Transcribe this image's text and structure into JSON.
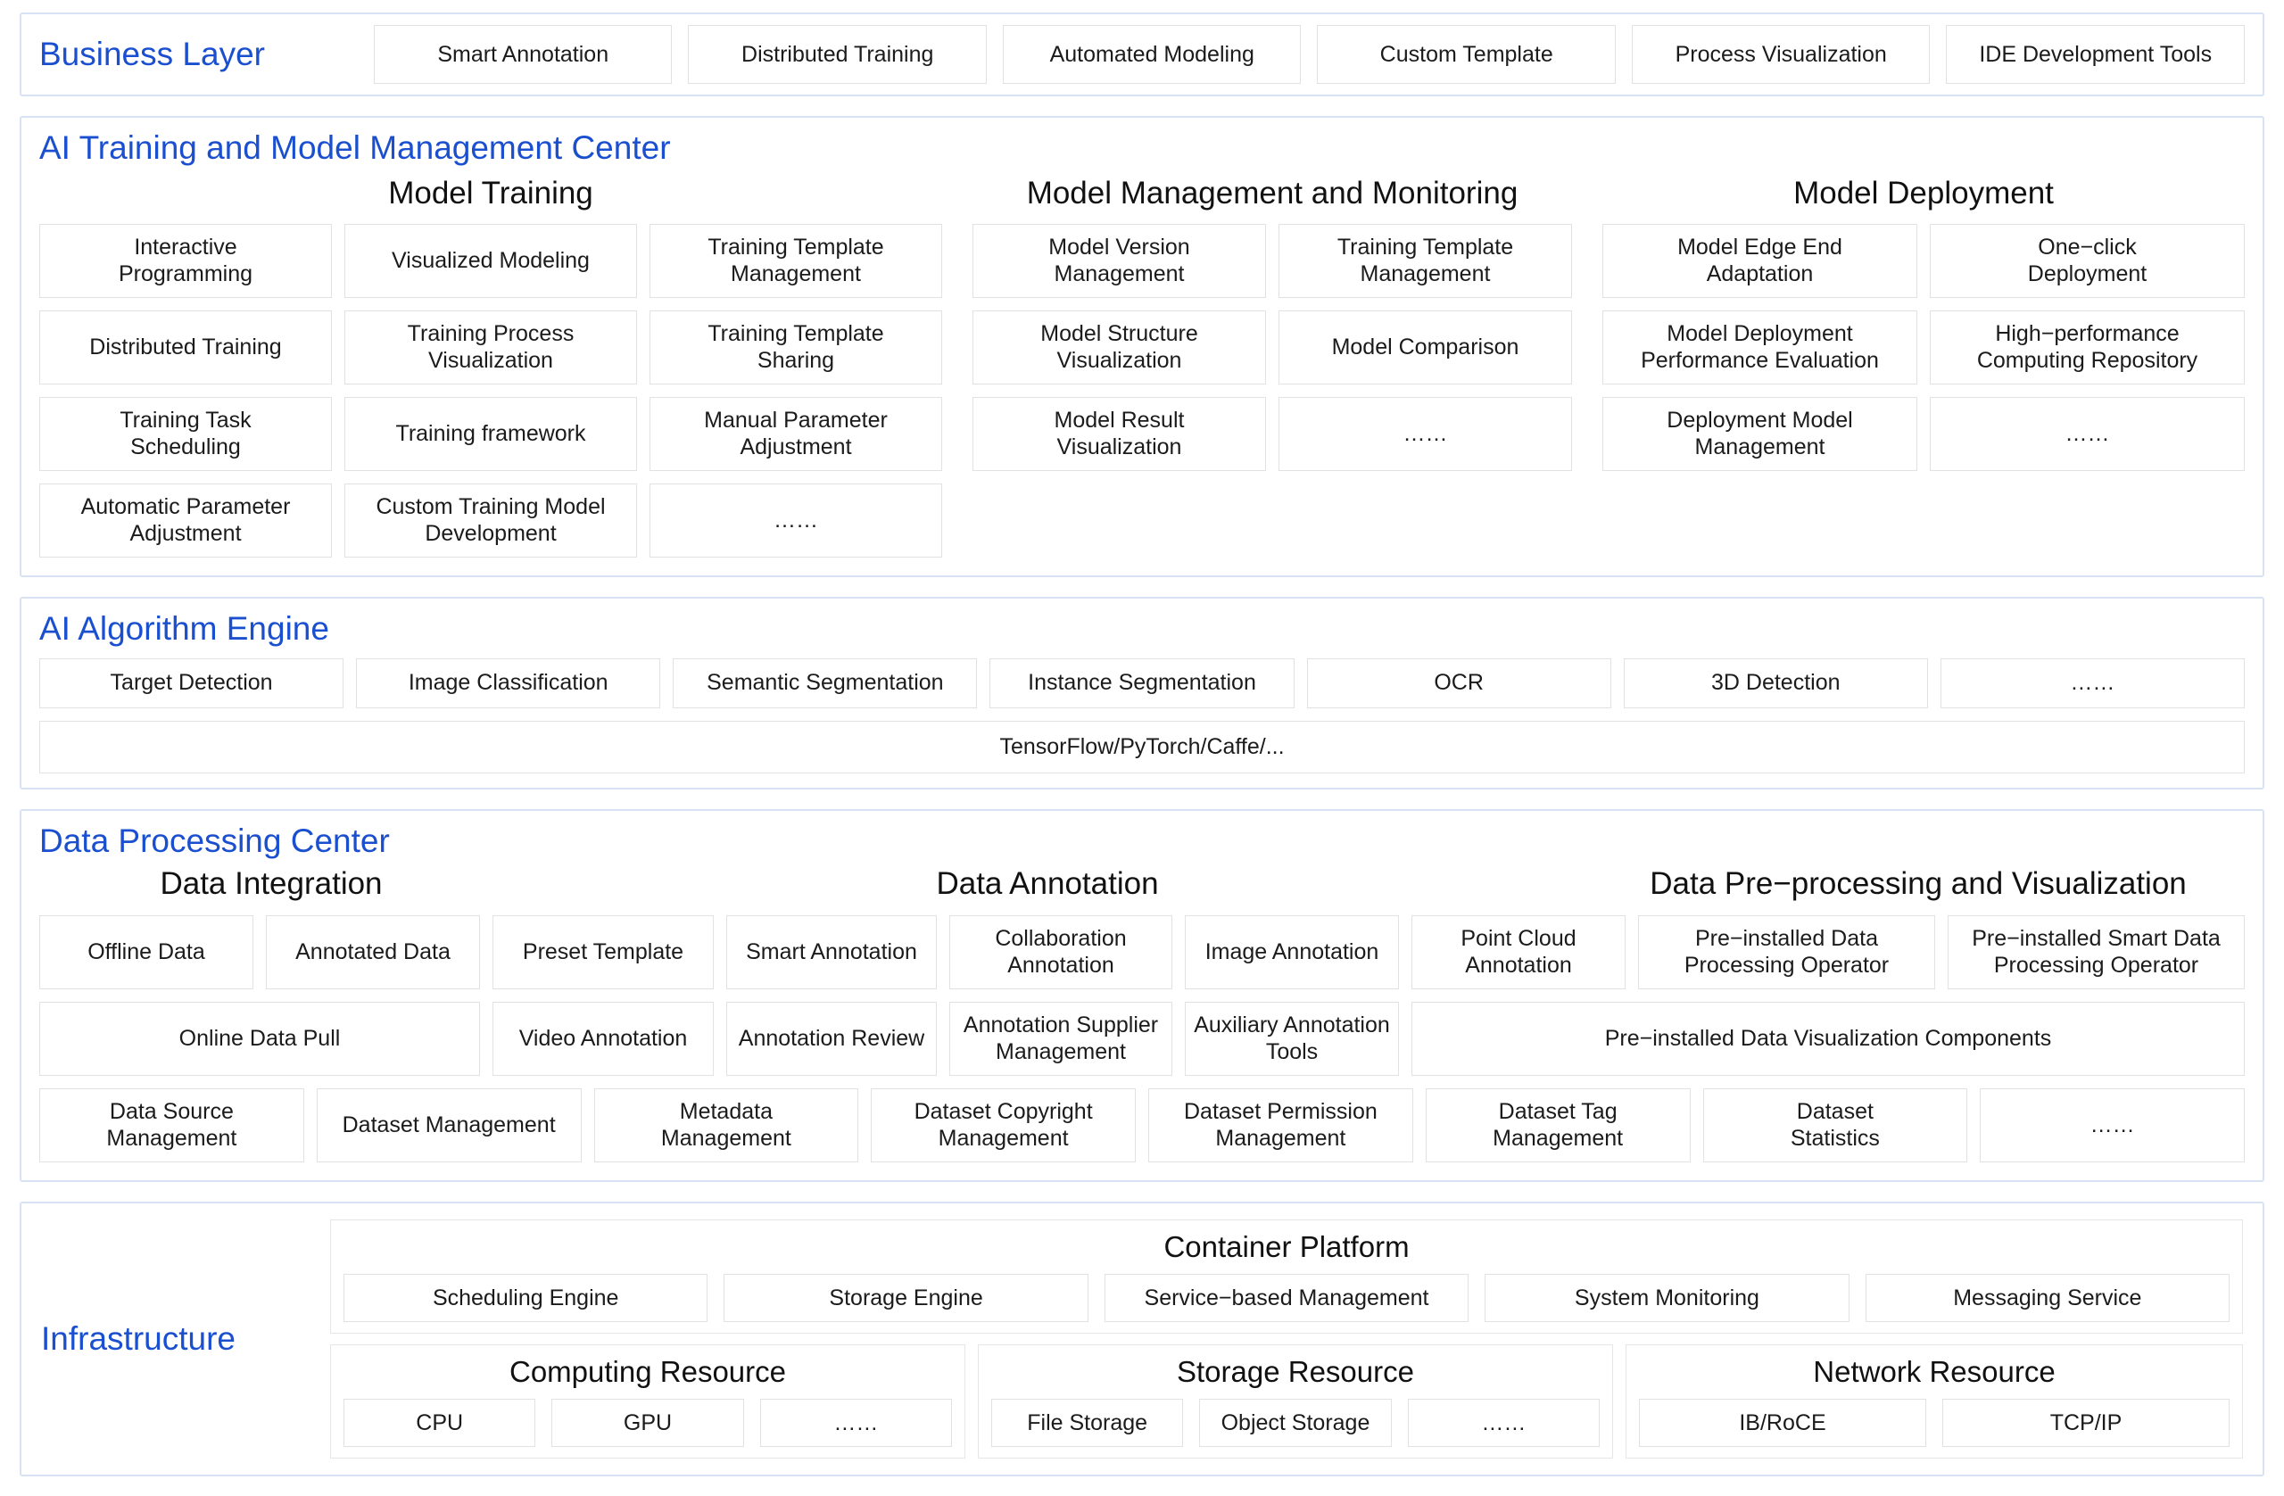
{
  "business": {
    "title": "Business Layer",
    "items": [
      "Smart Annotation",
      "Distributed Training",
      "Automated Modeling",
      "Custom Template",
      "Process Visualization",
      "IDE Development Tools"
    ]
  },
  "ai_training": {
    "title": "AI Training and Model Management Center",
    "columns": [
      {
        "title": "Model Training",
        "rows": [
          [
            "Interactive\nProgramming",
            "Visualized Modeling",
            "Training Template\nManagement"
          ],
          [
            "Distributed Training",
            "Training Process\nVisualization",
            "Training Template\nSharing"
          ],
          [
            "Training Task\nScheduling",
            "Training framework",
            "Manual Parameter\nAdjustment"
          ],
          [
            "Automatic Parameter\nAdjustment",
            "Custom Training Model\nDevelopment",
            "……"
          ]
        ]
      },
      {
        "title": "Model Management and Monitoring",
        "rows": [
          [
            "Model Version\nManagement",
            "Training Template\nManagement"
          ],
          [
            "Model Structure\nVisualization",
            "Model Comparison"
          ],
          [
            "Model Result\nVisualization",
            "……"
          ]
        ]
      },
      {
        "title": "Model Deployment",
        "rows": [
          [
            "Model Edge End\nAdaptation",
            "One−click\nDeployment"
          ],
          [
            "Model Deployment\nPerformance Evaluation",
            "High−performance\nComputing Repository"
          ],
          [
            "Deployment Model\nManagement",
            "……"
          ]
        ]
      }
    ]
  },
  "algorithm_engine": {
    "title": "AI Algorithm Engine",
    "items": [
      "Target Detection",
      "Image Classification",
      "Semantic Segmentation",
      "Instance Segmentation",
      "OCR",
      "3D Detection",
      "……"
    ],
    "frameworks": "TensorFlow/PyTorch/Caffe/..."
  },
  "data_processing": {
    "title": "Data Processing Center",
    "group_titles": {
      "integration": "Data Integration",
      "annotation": "Data Annotation",
      "preprocessing": "Data Pre−processing and Visualization"
    },
    "row1": [
      "Offline Data",
      "Annotated Data",
      "Preset Template",
      "Smart Annotation",
      "Collaboration\nAnnotation",
      "Image Annotation",
      "Point Cloud\nAnnotation",
      "Pre−installed Data\nProcessing Operator",
      "Pre−installed Smart Data\nProcessing Operator"
    ],
    "row2": [
      "Online Data Pull",
      "Video Annotation",
      "Annotation Review",
      "Annotation Supplier\nManagement",
      "Auxiliary Annotation\nTools",
      "Pre−installed Data Visualization Components"
    ],
    "row3": [
      "Data Source\nManagement",
      "Dataset Management",
      "Metadata\nManagement",
      "Dataset Copyright\nManagement",
      "Dataset Permission\nManagement",
      "Dataset Tag\nManagement",
      "Dataset\nStatistics",
      "……"
    ]
  },
  "infrastructure": {
    "title": "Infrastructure",
    "container_platform": {
      "title": "Container Platform",
      "items": [
        "Scheduling Engine",
        "Storage Engine",
        "Service−based Management",
        "System Monitoring",
        "Messaging Service"
      ]
    },
    "computing_resource": {
      "title": "Computing Resource",
      "items": [
        "CPU",
        "GPU",
        "……"
      ]
    },
    "storage_resource": {
      "title": "Storage Resource",
      "items": [
        "File Storage",
        "Object Storage",
        "……"
      ]
    },
    "network_resource": {
      "title": "Network Resource",
      "items": [
        "IB/RoCE",
        "TCP/IP"
      ]
    }
  },
  "colors": {
    "accent": "#1a4fd0",
    "layer_border": "#d8e2f5",
    "cell_border": "#e2e2e2"
  }
}
